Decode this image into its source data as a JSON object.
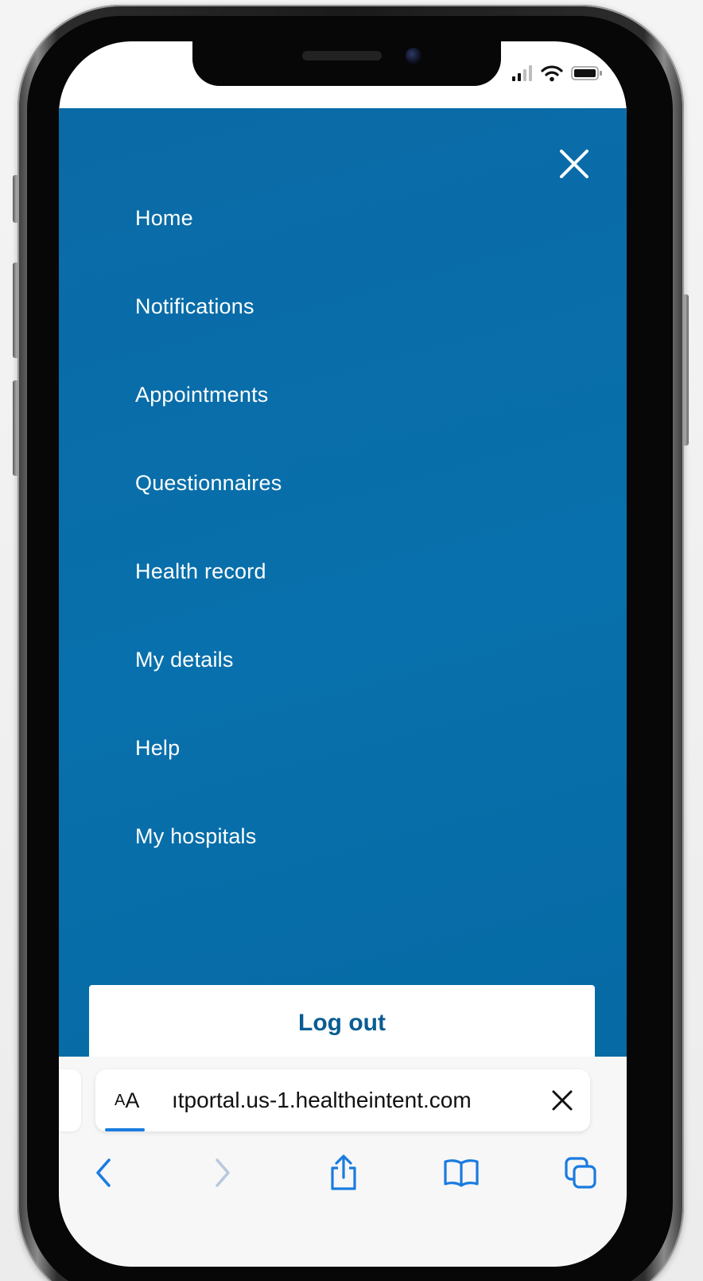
{
  "menu": {
    "items": [
      {
        "label": "Home"
      },
      {
        "label": "Notifications"
      },
      {
        "label": "Appointments"
      },
      {
        "label": "Questionnaires"
      },
      {
        "label": "Health record"
      },
      {
        "label": "My details"
      },
      {
        "label": "Help"
      },
      {
        "label": "My hospitals"
      }
    ],
    "logout_label": "Log out"
  },
  "browser": {
    "aa_small": "A",
    "aa_large": "A",
    "url": "ıtportal.us-1.healtheintent.com"
  },
  "colors": {
    "menu_background": "#0870ac",
    "logout_text": "#0a5c92",
    "browser_accent": "#1a7be0"
  },
  "icons": {
    "close": "close-icon",
    "back": "chevron-left-icon",
    "forward": "chevron-right-icon",
    "share": "share-icon",
    "bookmarks": "book-icon",
    "tabs": "tabs-icon",
    "signal": "cellular-signal-icon",
    "wifi": "wifi-icon",
    "battery": "battery-icon"
  }
}
